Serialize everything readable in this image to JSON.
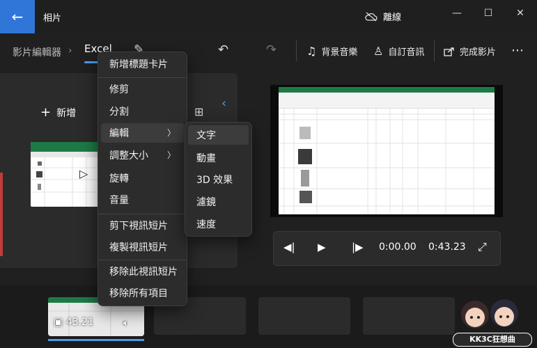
{
  "titlebar": {
    "title": "相片",
    "offline_label": "離線"
  },
  "toolbar": {
    "crumb_editor": "影片編輯器",
    "project_name": "Excel",
    "bg_music": "背景音樂",
    "custom_audio": "自訂音訊",
    "finish_video": "完成影片"
  },
  "library": {
    "add_label": "新增"
  },
  "context_menu": {
    "items": [
      "新增標題卡片",
      "修剪",
      "分割",
      "編輯",
      "調整大小",
      "旋轉",
      "音量",
      "剪下視訊短片",
      "複製視訊短片",
      "移除此視訊短片",
      "移除所有項目"
    ]
  },
  "submenu": {
    "items": [
      "文字",
      "動畫",
      "3D 效果",
      "濾鏡",
      "速度"
    ]
  },
  "player": {
    "current_time": "0:00.00",
    "total_time": "0:43.23"
  },
  "storyboard": {
    "clip_duration": "43.21"
  },
  "watermark": {
    "text": "KK3C狂想曲"
  }
}
